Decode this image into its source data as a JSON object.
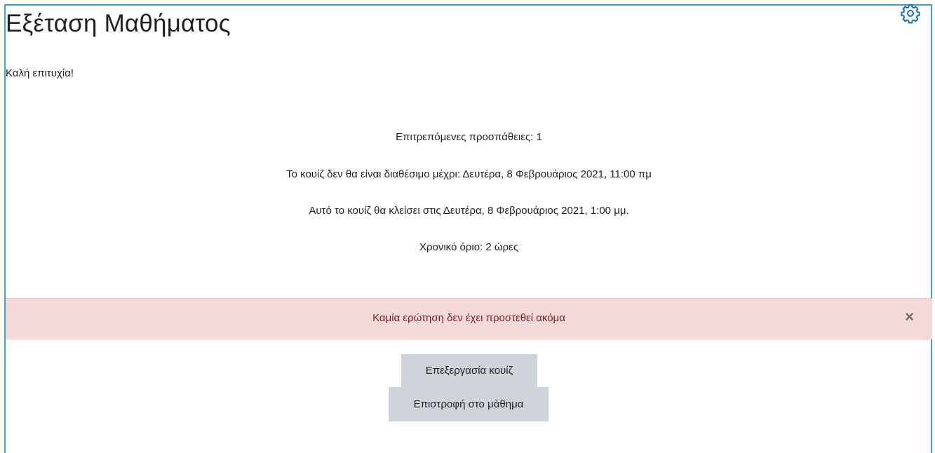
{
  "page": {
    "title": "Εξέταση Μαθήματος",
    "intro": "Καλή επιτυχία!"
  },
  "quiz_info": {
    "attempts": "Επιτρεπόμενες προσπάθειες: 1",
    "opens": "Το κουίζ δεν θα είναι διαθέσιμο μέχρι: Δευτέρα, 8 Φεβρουάριος 2021, 11:00 πμ",
    "closes": "Αυτό το κουίζ θα κλείσει στις Δευτέρα, 8 Φεβρουάριος 2021, 1:00 μμ.",
    "time_limit": "Χρονικό όριο: 2 ώρες"
  },
  "alert": {
    "message": "Καμία ερώτηση δεν έχει προστεθεί ακόμα",
    "close_glyph": "×"
  },
  "buttons": {
    "edit_quiz": "Επεξεργασία κουίζ",
    "back_to_course": "Επιστροφή στο μάθημα"
  },
  "icons": {
    "settings": "gear-icon"
  },
  "colors": {
    "frame_border": "#3aa0d6",
    "gear_icon": "#0f6fc5",
    "alert_bg": "#f6d9d9",
    "alert_text": "#7b1e1e",
    "button_bg": "#ced4da"
  }
}
